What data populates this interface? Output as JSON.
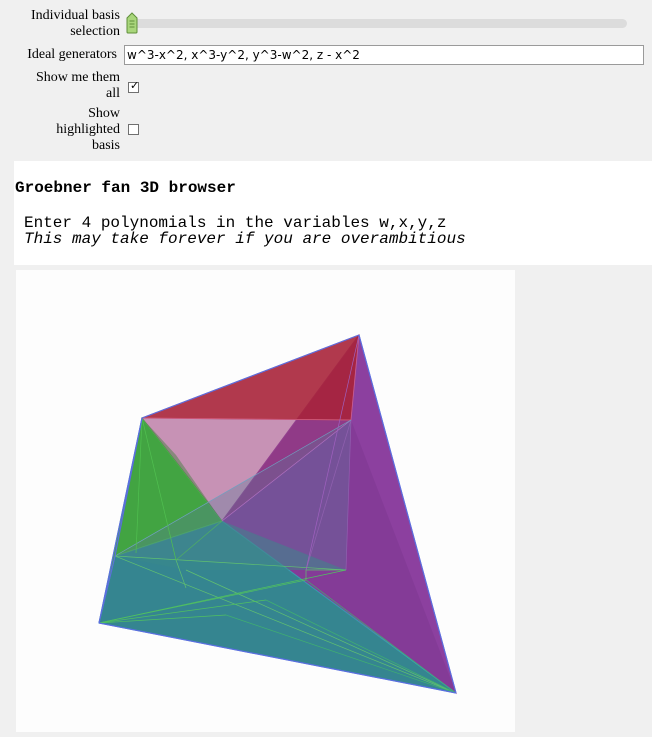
{
  "controls": {
    "basis_selection_label_line1": "Individual basis",
    "basis_selection_label_line2": "selection",
    "generators_label": "Ideal generators",
    "generators_value": "w^3-x^2, x^3-y^2, y^3-w^2, z - x^2",
    "show_all_label_line1": "Show me them",
    "show_all_label_line2": "all",
    "show_all_checked": true,
    "show_highlighted_label_line1": "Show",
    "show_highlighted_label_line2": "highlighted",
    "show_highlighted_label_line3": "basis",
    "show_highlighted_checked": false,
    "checkmark_glyph": "✓",
    "slider_value_fraction": 0.0
  },
  "output": {
    "title": "Groebner fan 3D browser",
    "line1": "Enter 4 polynomials in the variables w,x,y,z",
    "line2": "This may take forever if you are overambitious"
  },
  "colors": {
    "page_bg": "#f0f0f0",
    "red_face": "#a8243a",
    "purple_face": "#7a2a8e",
    "green_face": "#2e9a2e",
    "teal_face": "#2a7e8a",
    "edge_blue": "#5a6ee0",
    "slider_thumb": "#9acb6a"
  }
}
